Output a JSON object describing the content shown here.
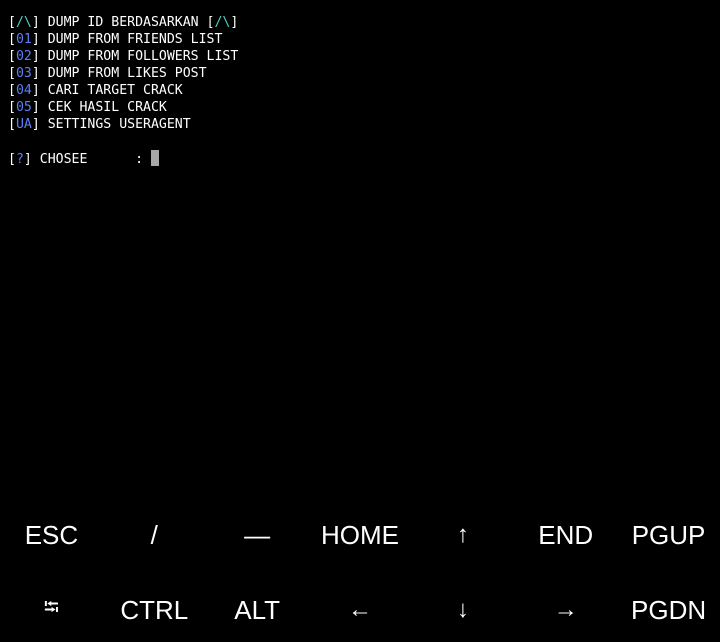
{
  "terminal": {
    "menu": [
      {
        "tag": "/\\",
        "tag_style": "teal",
        "text": "DUMP ID BERDASARKAN ",
        "suffix_tag": "/\\"
      },
      {
        "tag": "01",
        "tag_style": "blue",
        "text": "DUMP FROM FRIENDS LIST"
      },
      {
        "tag": "02",
        "tag_style": "blue",
        "text": "DUMP FROM FOLLOWERS LIST"
      },
      {
        "tag": "03",
        "tag_style": "blue",
        "text": "DUMP FROM LIKES POST"
      },
      {
        "tag": "04",
        "tag_style": "blue",
        "text": "CARI TARGET CRACK"
      },
      {
        "tag": "05",
        "tag_style": "blue",
        "text": "CEK HASIL CRACK"
      },
      {
        "tag": "UA",
        "tag_style": "blue",
        "text": "SETTINGS USERAGENT"
      }
    ],
    "prompt": {
      "tag": "?",
      "label": "CHOSEE",
      "separator": ":",
      "value": ""
    }
  },
  "extra_keys": {
    "row1": [
      {
        "label": "ESC",
        "name": "esc-key"
      },
      {
        "label": "/",
        "name": "slash-key"
      },
      {
        "label": "—",
        "name": "dash-key"
      },
      {
        "label": "HOME",
        "name": "home-key"
      },
      {
        "label": "↑",
        "name": "arrow-up-key"
      },
      {
        "label": "END",
        "name": "end-key"
      },
      {
        "label": "PGUP",
        "name": "page-up-key"
      }
    ],
    "row2": [
      {
        "label": "⭾",
        "name": "tab-key"
      },
      {
        "label": "CTRL",
        "name": "ctrl-key"
      },
      {
        "label": "ALT",
        "name": "alt-key"
      },
      {
        "label": "←",
        "name": "arrow-left-key"
      },
      {
        "label": "↓",
        "name": "arrow-down-key"
      },
      {
        "label": "→",
        "name": "arrow-right-key"
      },
      {
        "label": "PGDN",
        "name": "page-down-key"
      }
    ]
  },
  "colors": {
    "background": "#000000",
    "text": "#ffffff",
    "tag_teal": "#4fd1c5",
    "tag_blue": "#5b7ff5",
    "cursor": "#a8a8a8"
  }
}
